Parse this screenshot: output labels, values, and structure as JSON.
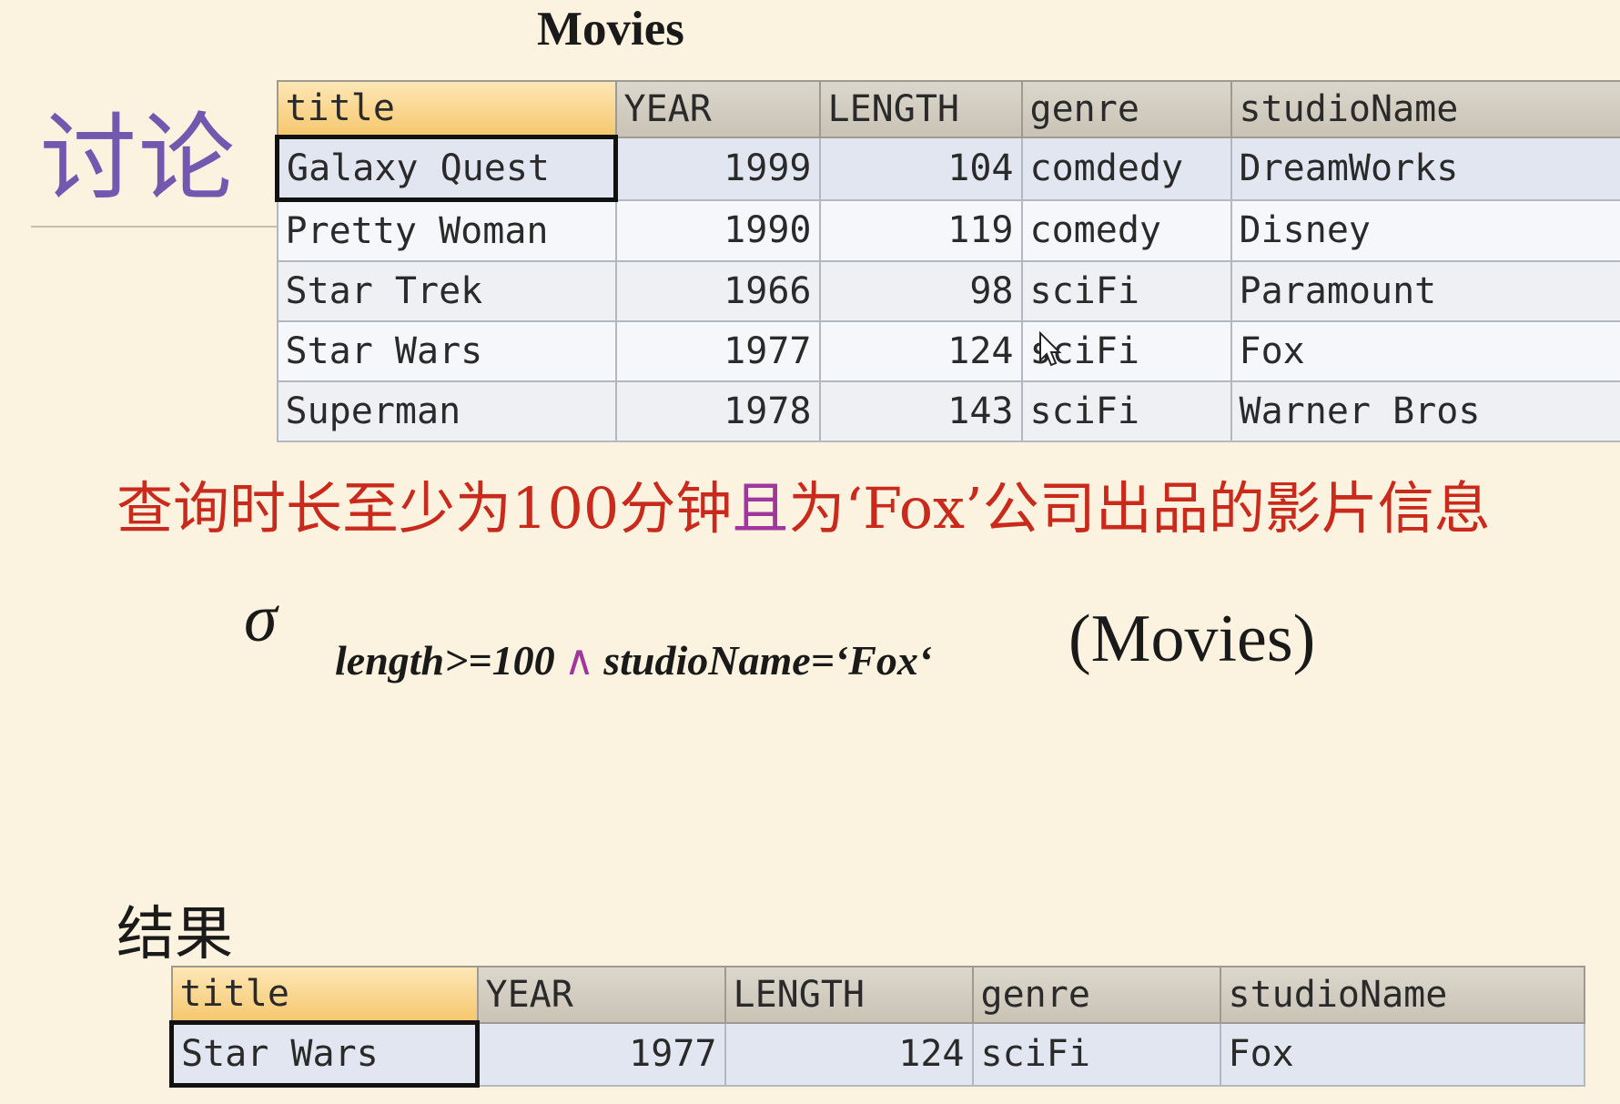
{
  "movies_title": "Movies",
  "heading": "讨论",
  "columns": [
    "title",
    "YEAR",
    "LENGTH",
    "genre",
    "studioName"
  ],
  "movies": [
    {
      "title": "Galaxy Quest",
      "year": "1999",
      "length": "104",
      "genre": "comdedy",
      "studio": "DreamWorks"
    },
    {
      "title": "Pretty Woman",
      "year": "1990",
      "length": "119",
      "genre": "comedy",
      "studio": "Disney"
    },
    {
      "title": "Star Trek",
      "year": "1966",
      "length": "98",
      "genre": "sciFi",
      "studio": "Paramount"
    },
    {
      "title": "Star Wars",
      "year": "1977",
      "length": "124",
      "genre": "sciFi",
      "studio": "Fox"
    },
    {
      "title": "Superman",
      "year": "1978",
      "length": "143",
      "genre": "sciFi",
      "studio": "Warner Bros"
    }
  ],
  "question": {
    "part1": "查询时长至少为100分钟",
    "and_word": "且",
    "part2": "为‘Fox’公司出品的影片信息"
  },
  "formula": {
    "sigma": "σ",
    "cond_left": "length>=100",
    "and_symbol": "∧",
    "cond_right": "studioName=‘Fox‘",
    "argument": "(Movies)"
  },
  "result_label": "结果",
  "result": [
    {
      "title": "Star Wars",
      "year": "1977",
      "length": "124",
      "genre": "sciFi",
      "studio": "Fox"
    }
  ],
  "icons": {
    "cursor": "mouse-pointer-icon"
  }
}
